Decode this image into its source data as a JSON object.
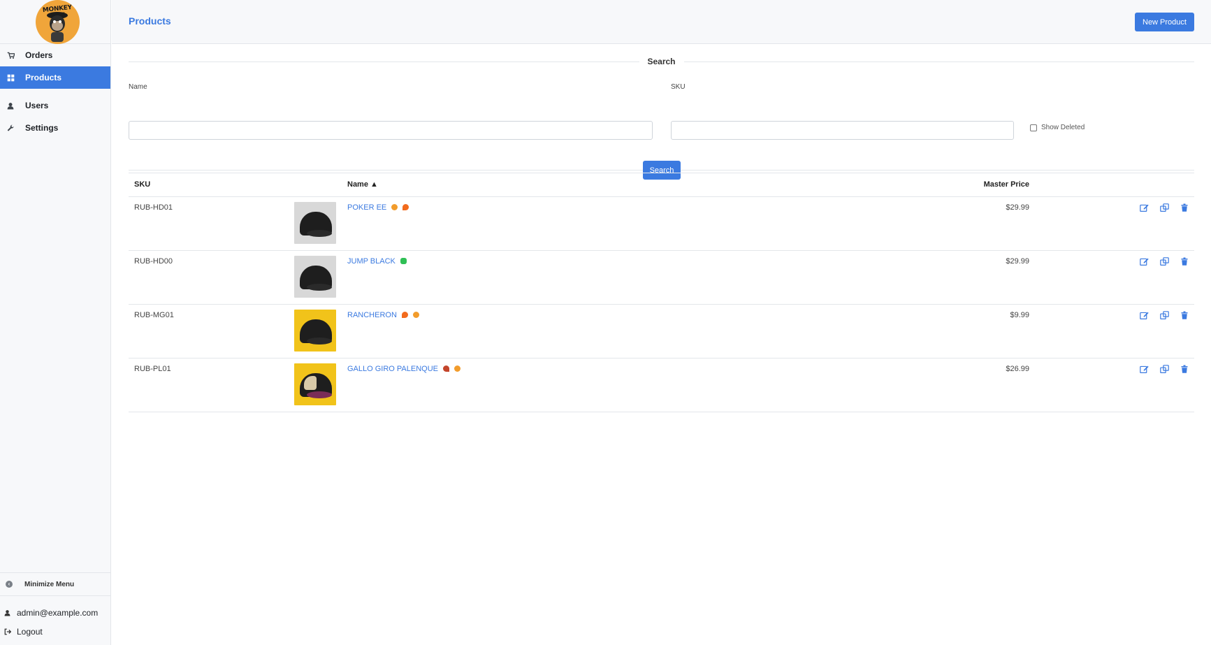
{
  "brand": {
    "logo_text": "MONKEY HAT"
  },
  "sidebar": {
    "items": [
      {
        "label": "Orders",
        "icon": "cart-icon",
        "active": false
      },
      {
        "label": "Products",
        "icon": "grid-icon",
        "active": true
      },
      {
        "label": "Users",
        "icon": "user-icon",
        "active": false
      },
      {
        "label": "Settings",
        "icon": "wrench-icon",
        "active": false
      }
    ],
    "minimize_label": "Minimize Menu",
    "user_email": "admin@example.com",
    "logout_label": "Logout"
  },
  "header": {
    "title": "Products",
    "new_button": "New Product"
  },
  "search": {
    "title": "Search",
    "name_label": "Name",
    "name_value": "",
    "sku_label": "SKU",
    "sku_value": "",
    "show_deleted_label": "Show Deleted",
    "show_deleted_checked": false,
    "button": "Search"
  },
  "table": {
    "columns": {
      "sku": "SKU",
      "name": "Name",
      "sort_indicator": "▲",
      "price": "Master Price"
    },
    "rows": [
      {
        "sku": "RUB-HD01",
        "name": "POKER EE",
        "emojis": [
          "smiling-face-hearts",
          "fire"
        ],
        "price": "$29.99",
        "thumb": "grey"
      },
      {
        "sku": "RUB-HD00",
        "name": "JUMP BLACK",
        "emojis": [
          "four-leaf-clover"
        ],
        "price": "$29.99",
        "thumb": "grey"
      },
      {
        "sku": "RUB-MG01",
        "name": "RANCHERON",
        "emojis": [
          "fire",
          "smiling-face-hearts"
        ],
        "price": "$9.99",
        "thumb": "yellow"
      },
      {
        "sku": "RUB-PL01",
        "name": "GALLO GIRO PALENQUE",
        "emojis": [
          "rooster",
          "smiling-face-hearts"
        ],
        "price": "$26.99",
        "thumb": "yellow-two"
      }
    ]
  },
  "colors": {
    "accent": "#3b7ae0",
    "sidebar_bg": "#f7f8fa",
    "border": "#e3e6ea"
  }
}
